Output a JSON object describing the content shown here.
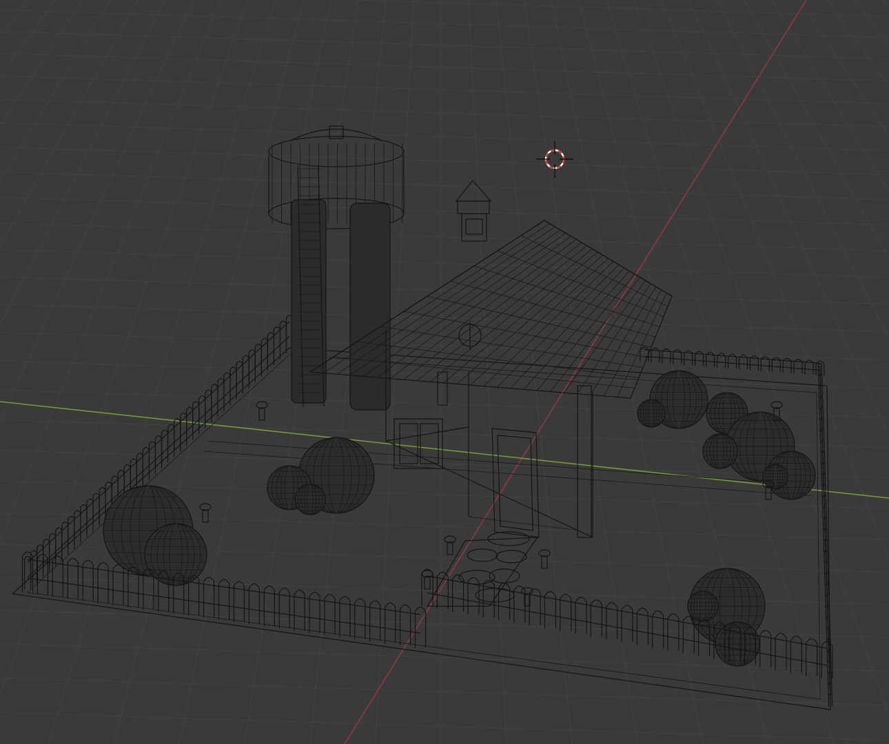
{
  "viewport": {
    "mode": "wireframe",
    "background_color": "#3a3a3a",
    "grid_color": "#444444",
    "x_axis_color": "#8b3a44",
    "y_axis_color": "#7a9a36",
    "wire_color": "#141414"
  },
  "scene": {
    "objects": [
      {
        "name": "water-tower",
        "icon": "tower"
      },
      {
        "name": "barn",
        "icon": "barn"
      },
      {
        "name": "cupola",
        "icon": "cupola"
      },
      {
        "name": "silo",
        "icon": "cylinder"
      },
      {
        "name": "fence",
        "icon": "fence"
      },
      {
        "name": "bushes",
        "icon": "sphere"
      },
      {
        "name": "stone-path",
        "icon": "path"
      },
      {
        "name": "posts",
        "icon": "post"
      }
    ]
  },
  "cursor_3d": {
    "icon": "crosshair-cursor-icon",
    "colors": [
      "#d83a3a",
      "#ffffff"
    ]
  }
}
